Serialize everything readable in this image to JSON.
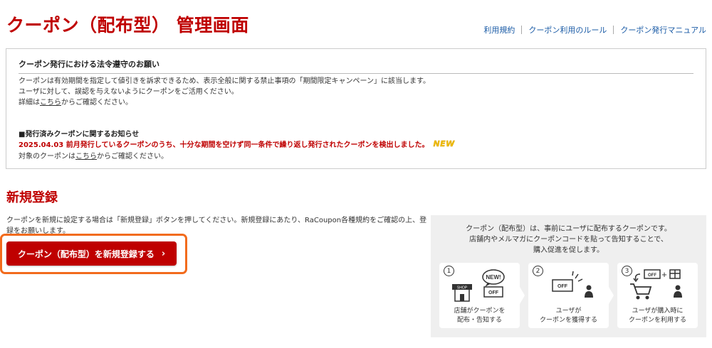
{
  "page_title": "クーポン（配布型） 管理画面",
  "top_links": [
    "利用規約",
    "クーポン利用のルール",
    "クーポン発行マニュアル"
  ],
  "notice": {
    "heading": "クーポン発行における法令遵守のお願い",
    "line1": "クーポンは有効期間を指定して値引きを訴求できるため、表示全般に関する禁止事項の「期間限定キャンペーン」に該当します。",
    "line2": "ユーザに対して、誤認を与えないようにクーポンをご活用ください。",
    "line3_prefix": "詳細は",
    "line3_link": "こちら",
    "line3_suffix": "からご確認ください。",
    "notice2_title": "■発行済みクーポンに関するお知らせ",
    "notice2_alert": "2025.04.03 前月発行しているクーポンのうち、十分な期間を空けず同一条件で繰り返し発行されたクーポンを検出しました。",
    "new_badge": "NEW",
    "ref_prefix": "対象のクーポンは",
    "ref_link": "こちら",
    "ref_suffix": "からご確認ください。"
  },
  "registration": {
    "title": "新規登録",
    "description": "クーポンを新規に設定する場合は「新規登録」ボタンを押してください。新規登録にあたり、RaCoupon各種規約をご確認の上、登録をお願いします。",
    "button_label": "クーポン（配布型）を新規登録する",
    "button_chevron": "›"
  },
  "info_panel": {
    "line1": "クーポン（配布型）は、事前にユーザに配布するクーポンです。",
    "line2": "店舗内やメルマガにクーポンコードを貼って告知することで、",
    "line3": "購入促進を促します。",
    "steps": [
      {
        "number": "1",
        "caption1": "店舗がクーポンを",
        "caption2": "配布・告知する",
        "art_labels": {
          "shop": "SHOP",
          "new": "NEW!",
          "off": "OFF"
        }
      },
      {
        "number": "2",
        "caption1": "ユーザが",
        "caption2": "クーポンを獲得する",
        "art_labels": {
          "off": "OFF"
        }
      },
      {
        "number": "3",
        "caption1": "ユーザが購入時に",
        "caption2": "クーポンを利用する",
        "art_labels": {
          "off": "OFF",
          "plus": "+"
        }
      }
    ]
  },
  "colors": {
    "brand_red": "#bf0000",
    "highlight_orange": "#f26b1d",
    "link_blue": "#1a5ba6",
    "badge_yellow": "#f2c000"
  }
}
